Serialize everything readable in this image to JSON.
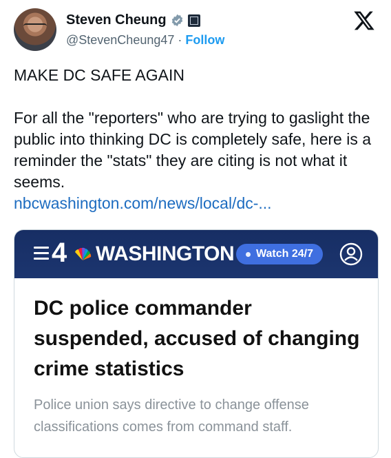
{
  "author": {
    "name": "Steven Cheung",
    "handle": "@StevenCheung47",
    "separator": "·",
    "follow_label": "Follow"
  },
  "tweet": {
    "line1": "MAKE DC SAFE AGAIN",
    "body": "For all the \"reporters\" who are trying to gaslight the public into thinking DC is completely safe, here is a reminder the \"stats\" they are citing is not what it seems.",
    "link": "nbcwashington.com/news/local/dc-..."
  },
  "card": {
    "logo_number": "4",
    "logo_text": "WASHINGTON",
    "watch_label": "Watch 24/7",
    "headline": "DC police commander suspended, accused of changing crime statistics",
    "subhead": "Police union says directive to change offense classifications comes from command staff."
  },
  "colors": {
    "link": "#1d6cc0",
    "follow": "#1d9bf0",
    "header_bg": "#1c356f",
    "watch_bg": "#3f6fe0"
  },
  "icons": [
    "verified-badge-icon",
    "affiliate-badge-icon",
    "x-logo-icon",
    "menu-icon",
    "peacock-icon",
    "user-account-icon"
  ]
}
